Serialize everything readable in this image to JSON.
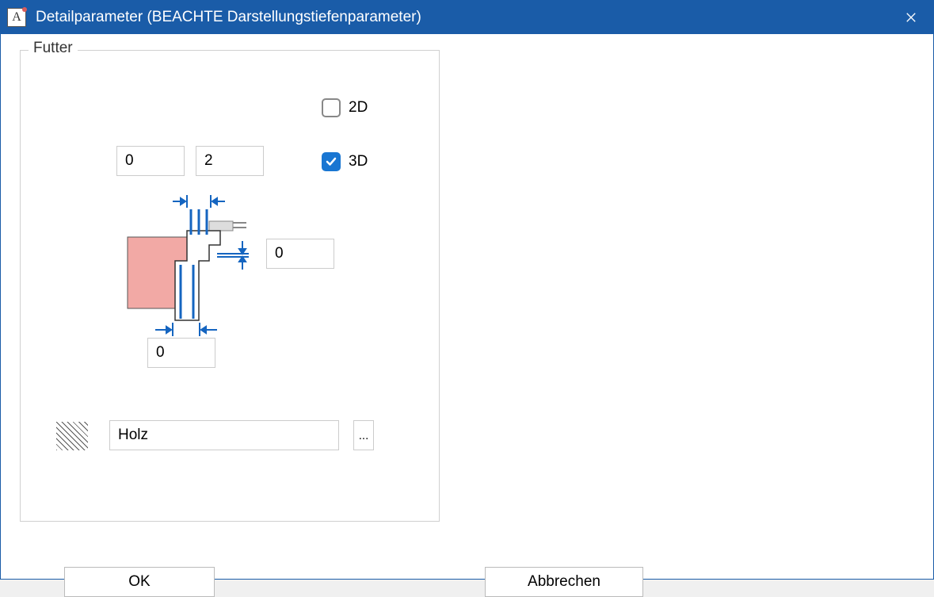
{
  "titlebar": {
    "icon_letter": "A",
    "title": "Detailparameter (BEACHTE Darstellungstiefenparameter)"
  },
  "groupbox": {
    "title": "Futter"
  },
  "checkboxes": {
    "cb2d": {
      "label": "2D",
      "checked": false
    },
    "cb3d": {
      "label": "3D",
      "checked": true
    }
  },
  "inputs": {
    "top_left": "0",
    "top_right": "2",
    "right_mid": "0",
    "bottom": "0"
  },
  "material": {
    "value": "Holz",
    "browse": "..."
  },
  "buttons": {
    "ok": "OK",
    "cancel": "Abbrechen"
  }
}
